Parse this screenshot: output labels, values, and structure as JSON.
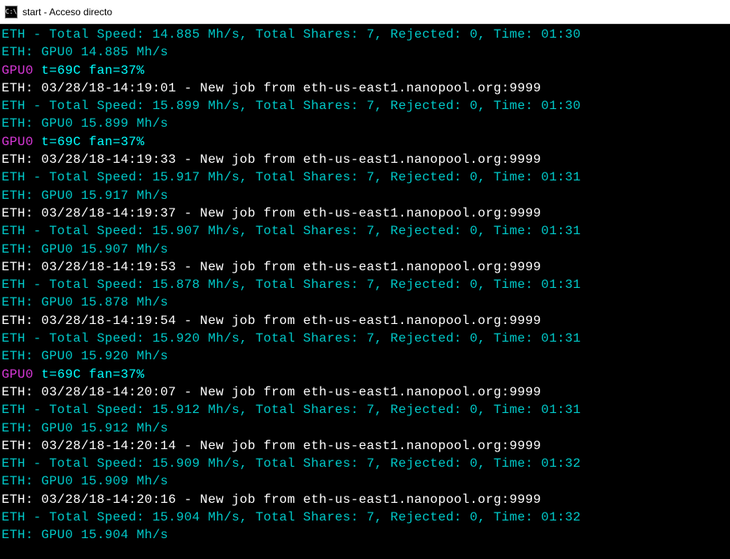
{
  "window": {
    "icon_text": "C:\\",
    "title": "start - Acceso directo"
  },
  "lines": [
    {
      "cls": "c-teal",
      "text": "ETH - Total Speed: 14.885 Mh/s, Total Shares: 7, Rejected: 0, Time: 01:30"
    },
    {
      "cls": "c-teal",
      "text": "ETH: GPU0 14.885 Mh/s"
    },
    {
      "segments": [
        {
          "cls": "c-magenta",
          "text": "GPU0"
        },
        {
          "cls": "c-cyan",
          "text": " t=69C fan=37%"
        }
      ]
    },
    {
      "cls": "c-white",
      "text": "ETH: 03/28/18-14:19:01 - New job from eth-us-east1.nanopool.org:9999"
    },
    {
      "cls": "c-teal",
      "text": "ETH - Total Speed: 15.899 Mh/s, Total Shares: 7, Rejected: 0, Time: 01:30"
    },
    {
      "cls": "c-teal",
      "text": "ETH: GPU0 15.899 Mh/s"
    },
    {
      "segments": [
        {
          "cls": "c-magenta",
          "text": "GPU0"
        },
        {
          "cls": "c-cyan",
          "text": " t=69C fan=37%"
        }
      ]
    },
    {
      "cls": "c-white",
      "text": "ETH: 03/28/18-14:19:33 - New job from eth-us-east1.nanopool.org:9999"
    },
    {
      "cls": "c-teal",
      "text": "ETH - Total Speed: 15.917 Mh/s, Total Shares: 7, Rejected: 0, Time: 01:31"
    },
    {
      "cls": "c-teal",
      "text": "ETH: GPU0 15.917 Mh/s"
    },
    {
      "cls": "c-white",
      "text": "ETH: 03/28/18-14:19:37 - New job from eth-us-east1.nanopool.org:9999"
    },
    {
      "cls": "c-teal",
      "text": "ETH - Total Speed: 15.907 Mh/s, Total Shares: 7, Rejected: 0, Time: 01:31"
    },
    {
      "cls": "c-teal",
      "text": "ETH: GPU0 15.907 Mh/s"
    },
    {
      "cls": "c-white",
      "text": "ETH: 03/28/18-14:19:53 - New job from eth-us-east1.nanopool.org:9999"
    },
    {
      "cls": "c-teal",
      "text": "ETH - Total Speed: 15.878 Mh/s, Total Shares: 7, Rejected: 0, Time: 01:31"
    },
    {
      "cls": "c-teal",
      "text": "ETH: GPU0 15.878 Mh/s"
    },
    {
      "cls": "c-white",
      "text": "ETH: 03/28/18-14:19:54 - New job from eth-us-east1.nanopool.org:9999"
    },
    {
      "cls": "c-teal",
      "text": "ETH - Total Speed: 15.920 Mh/s, Total Shares: 7, Rejected: 0, Time: 01:31"
    },
    {
      "cls": "c-teal",
      "text": "ETH: GPU0 15.920 Mh/s"
    },
    {
      "segments": [
        {
          "cls": "c-magenta",
          "text": "GPU0"
        },
        {
          "cls": "c-cyan",
          "text": " t=69C fan=37%"
        }
      ]
    },
    {
      "cls": "c-white",
      "text": "ETH: 03/28/18-14:20:07 - New job from eth-us-east1.nanopool.org:9999"
    },
    {
      "cls": "c-teal",
      "text": "ETH - Total Speed: 15.912 Mh/s, Total Shares: 7, Rejected: 0, Time: 01:31"
    },
    {
      "cls": "c-teal",
      "text": "ETH: GPU0 15.912 Mh/s"
    },
    {
      "cls": "c-white",
      "text": "ETH: 03/28/18-14:20:14 - New job from eth-us-east1.nanopool.org:9999"
    },
    {
      "cls": "c-teal",
      "text": "ETH - Total Speed: 15.909 Mh/s, Total Shares: 7, Rejected: 0, Time: 01:32"
    },
    {
      "cls": "c-teal",
      "text": "ETH: GPU0 15.909 Mh/s"
    },
    {
      "cls": "c-white",
      "text": "ETH: 03/28/18-14:20:16 - New job from eth-us-east1.nanopool.org:9999"
    },
    {
      "cls": "c-teal",
      "text": "ETH - Total Speed: 15.904 Mh/s, Total Shares: 7, Rejected: 0, Time: 01:32"
    },
    {
      "cls": "c-teal",
      "text": "ETH: GPU0 15.904 Mh/s"
    }
  ]
}
